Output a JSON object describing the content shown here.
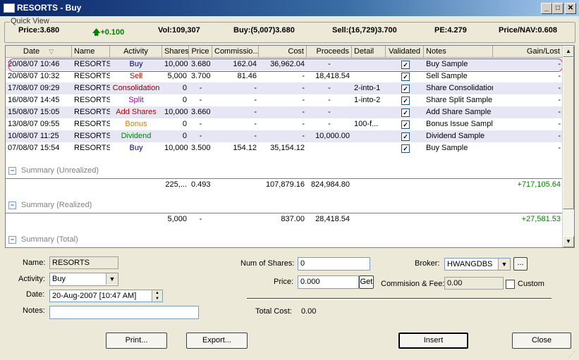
{
  "window": {
    "title": "RESORTS - Buy"
  },
  "quick_view": {
    "legend": "Quick View",
    "price": "Price:3.680",
    "change": "+0.100",
    "vol": "Vol:109,307",
    "buy": "Buy:(5,007)3.680",
    "sell": "Sell:(16,729)3.700",
    "pe": "PE:4.279",
    "price_nav": "Price/NAV:0.608"
  },
  "columns": [
    "Date",
    "Name",
    "Activity",
    "Shares",
    "Price",
    "Commissio...",
    "Cost",
    "Proceeds",
    "Detail",
    "Validated",
    "Notes",
    "Gain/Lost"
  ],
  "rows": [
    {
      "date": "20/08/07 10:46",
      "name": "RESORTS",
      "activity": "Buy",
      "activity_color": "#000080",
      "shares": "10,000",
      "price": "3.680",
      "commission": "162.04",
      "cost": "36,962.04",
      "proceeds": "-",
      "detail": "",
      "notes": "Buy Sample",
      "gain": "-"
    },
    {
      "date": "20/08/07 10:32",
      "name": "RESORTS",
      "activity": "Sell",
      "activity_color": "#c00000",
      "shares": "5,000",
      "price": "3.700",
      "commission": "81.46",
      "cost": "-",
      "proceeds": "18,418.54",
      "detail": "",
      "notes": "Sell Sample",
      "gain": "-"
    },
    {
      "date": "17/08/07 09:29",
      "name": "RESORTS",
      "activity": "Consolidation",
      "activity_color": "#800000",
      "shares": "0",
      "price": "-",
      "commission": "-",
      "cost": "-",
      "proceeds": "-",
      "detail": "2-into-1",
      "notes": "Share Consolidation S...",
      "gain": "-"
    },
    {
      "date": "16/08/07 14:45",
      "name": "RESORTS",
      "activity": "Split",
      "activity_color": "#a000a0",
      "shares": "0",
      "price": "-",
      "commission": "-",
      "cost": "-",
      "proceeds": "-",
      "detail": "1-into-2",
      "notes": "Share Split Sample",
      "gain": "-"
    },
    {
      "date": "15/08/07 15:05",
      "name": "RESORTS",
      "activity": "Add Shares",
      "activity_color": "#c00000",
      "shares": "10,000",
      "price": "3.660",
      "commission": "-",
      "cost": "-",
      "proceeds": "-",
      "detail": "",
      "notes": "Add Share Sample",
      "gain": "-"
    },
    {
      "date": "13/08/07 09:55",
      "name": "RESORTS",
      "activity": "Bonus",
      "activity_color": "#d08000",
      "shares": "0",
      "price": "-",
      "commission": "-",
      "cost": "-",
      "proceeds": "-",
      "detail": "100-f...",
      "notes": "Bonus Issue Sample",
      "gain": "-"
    },
    {
      "date": "10/08/07 11:25",
      "name": "RESORTS",
      "activity": "Dividend",
      "activity_color": "#008000",
      "shares": "0",
      "price": "-",
      "commission": "-",
      "cost": "-",
      "proceeds": "10,000.00",
      "detail": "",
      "notes": "Dividend Sample",
      "gain": "-"
    },
    {
      "date": "07/08/07 15:54",
      "name": "RESORTS",
      "activity": "Buy",
      "activity_color": "#000080",
      "shares": "10,000",
      "price": "3.500",
      "commission": "154.12",
      "cost": "35,154.12",
      "proceeds": "",
      "detail": "",
      "notes": "Buy Sample",
      "gain": "-"
    }
  ],
  "summary_unrealized": {
    "label": "Summary (Unrealized)",
    "shares": "225,...",
    "price": "0.493",
    "cost": "107,879.16",
    "proceeds": "824,984.80",
    "gain": "+717,105.64"
  },
  "summary_realized": {
    "label": "Summary (Realized)",
    "shares": "5,000",
    "price": "-",
    "cost": "837.00",
    "proceeds": "28,418.54",
    "gain": "+27,581.53"
  },
  "summary_total": {
    "label": "Summary (Total)"
  },
  "form": {
    "name_label": "Name:",
    "name_value": "RESORTS",
    "activity_label": "Activity:",
    "activity_value": "Buy",
    "date_label": "Date:",
    "date_value": "20-Aug-2007 [10:47 AM]",
    "notes_label": "Notes:",
    "notes_value": "",
    "num_shares_label": "Num of Shares:",
    "num_shares_value": "0",
    "price_label": "Price:",
    "price_value": "0.000",
    "get_label": "Get",
    "total_cost_label": "Total Cost:",
    "total_cost_value": "0.00",
    "broker_label": "Broker:",
    "broker_value": "HWANGDBS",
    "broker_more": "...",
    "commission_label": "Commision & Fee:",
    "commission_value": "0.00",
    "custom_label": "Custom"
  },
  "buttons": {
    "print": "Print...",
    "export": "Export...",
    "insert": "Insert",
    "close": "Close"
  },
  "colors": {
    "gain_positive": "#008000",
    "row_alt": "#e6e6f5",
    "selection_oval": "#d04050"
  }
}
